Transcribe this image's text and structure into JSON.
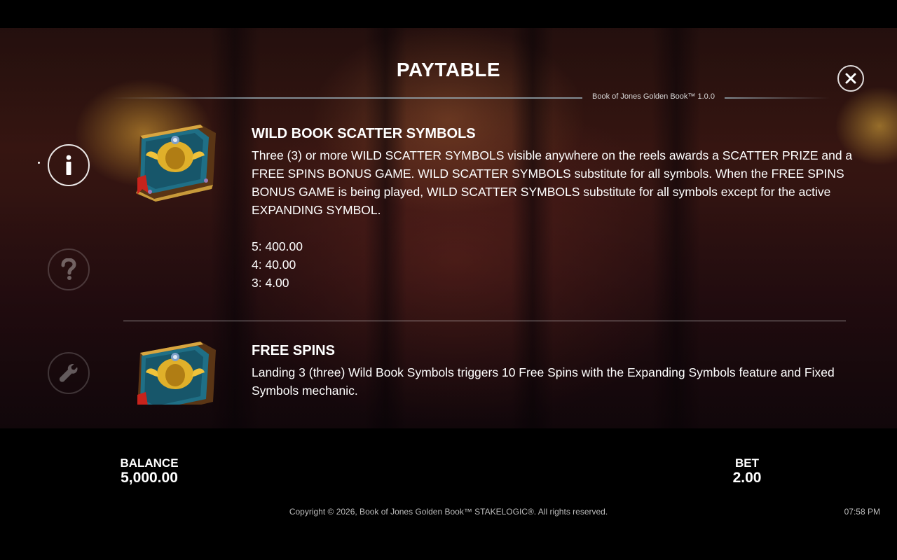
{
  "header": {
    "title": "PAYTABLE",
    "version": "Book of Jones Golden Book™ 1.0.0",
    "close_label": "X"
  },
  "nav": {
    "items": [
      {
        "name": "info",
        "icon": "info-icon",
        "glyph": "i",
        "active": true
      },
      {
        "name": "help",
        "icon": "question-icon",
        "glyph": "?",
        "active": false
      },
      {
        "name": "settings",
        "icon": "wrench-icon",
        "glyph": "",
        "active": false
      }
    ]
  },
  "sections": [
    {
      "icon": "golden-book-icon",
      "title": "WILD BOOK SCATTER SYMBOLS",
      "body": "Three (3) or more WILD SCATTER SYMBOLS visible anywhere on the reels awards a SCATTER PRIZE and a FREE SPINS BONUS GAME. WILD SCATTER SYMBOLS substitute for all symbols. When the FREE SPINS BONUS GAME is being played, WILD SCATTER SYMBOLS substitute for all symbols except for the active EXPANDING SYMBOL.",
      "payouts": [
        "5: 400.00",
        "4: 40.00",
        "3: 4.00"
      ]
    },
    {
      "icon": "golden-book-icon",
      "title": "FREE SPINS",
      "body": "Landing 3 (three) Wild Book Symbols triggers 10 Free Spins with the Expanding Symbols feature and Fixed Symbols mechanic."
    }
  ],
  "footer": {
    "balance_label": "BALANCE",
    "balance_value": "5,000.00",
    "bet_label": "BET",
    "bet_value": "2.00",
    "copyright": "Copyright © 2026, Book of Jones Golden Book™ STAKELOGIC®. All rights reserved.",
    "time": "07:58 PM"
  },
  "colors": {
    "background": "#000000",
    "text": "#ffffff",
    "book_teal": "#1f6f86",
    "book_gold": "#e0b02a",
    "ribbon": "#c8231c"
  }
}
